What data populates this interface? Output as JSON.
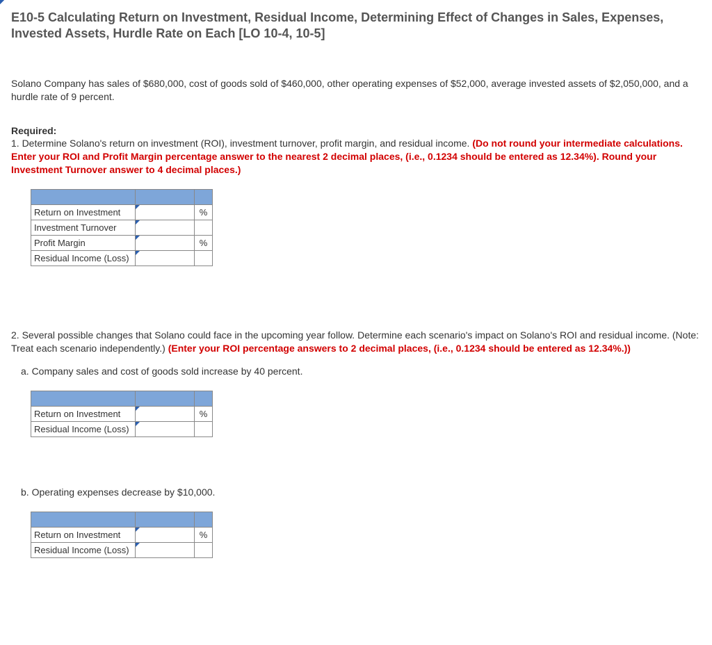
{
  "title": "E10-5 Calculating Return on Investment, Residual Income, Determining Effect of Changes in Sales, Expenses, Invested Assets, Hurdle Rate on Each [LO 10-4, 10-5]",
  "intro": "Solano Company has sales of $680,000, cost of goods sold of $460,000, other operating expenses of $52,000, average invested assets of $2,050,000, and a hurdle rate of 9 percent.",
  "required_label": "Required:",
  "q1_black": "1. Determine Solano's return on investment (ROI), investment turnover, profit margin, and residual income. ",
  "q1_red": "(Do not round your intermediate calculations. Enter your ROI and Profit Margin percentage answer to the nearest 2 decimal places, (i.e., 0.1234 should be entered as 12.34%). Round your Investment Turnover answer to 4 decimal places.)",
  "table1": {
    "rows": [
      {
        "label": "Return on Investment",
        "unit": "%"
      },
      {
        "label": "Investment Turnover",
        "unit": ""
      },
      {
        "label": "Profit Margin",
        "unit": "%"
      },
      {
        "label": "Residual Income (Loss)",
        "unit": ""
      }
    ]
  },
  "q2_black": "2. Several possible changes that Solano could face in the upcoming year follow. Determine each scenario's impact on Solano's ROI and residual income. (Note: Treat each scenario independently.) ",
  "q2_red": "(Enter your ROI percentage answers to 2 decimal places, (i.e., 0.1234 should be entered as 12.34%.))",
  "q2a_label": "a. Company sales and cost of goods sold increase by 40 percent.",
  "q2b_label": "b. Operating expenses decrease by $10,000.",
  "table2a": {
    "rows": [
      {
        "label": "Return on Investment",
        "unit": "%"
      },
      {
        "label": "Residual Income (Loss)",
        "unit": ""
      }
    ]
  },
  "table2b": {
    "rows": [
      {
        "label": "Return on Investment",
        "unit": "%"
      },
      {
        "label": "Residual Income (Loss)",
        "unit": ""
      }
    ]
  }
}
